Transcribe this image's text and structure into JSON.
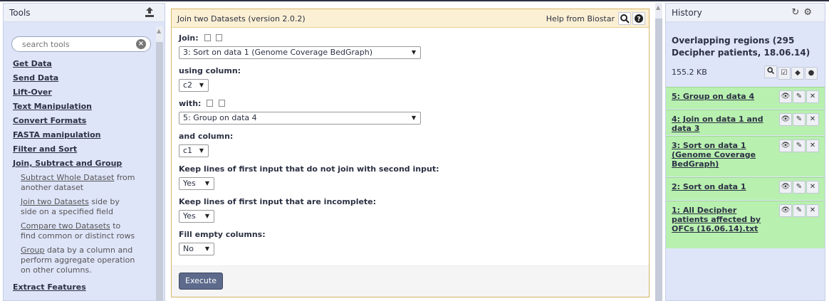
{
  "tools_panel": {
    "title": "Tools",
    "search_placeholder": "search tools",
    "sections": [
      "Get Data",
      "Send Data",
      "Lift-Over",
      "Text Manipulation",
      "Convert Formats",
      "FASTA manipulation",
      "Filter and Sort",
      "Join, Subtract and Group"
    ],
    "tools": [
      {
        "link": "Subtract Whole Dataset",
        "desc1": " from",
        "desc2": "another dataset"
      },
      {
        "link": "Join two Datasets",
        "desc1": " side by",
        "desc2": "side on a specified field"
      },
      {
        "link": "Compare two Datasets",
        "desc1": " to",
        "desc2": "find common or distinct rows"
      },
      {
        "link": "Group",
        "desc1": " data by a column and",
        "desc2": "perform aggregate operation",
        "desc3": "on other columns."
      }
    ],
    "last_section": "Extract Features"
  },
  "tool_form": {
    "title": "Join two Datasets (version 2.0.2)",
    "help": "Help from Biostar",
    "fields": [
      {
        "label": "Join:",
        "value": "3: Sort on data 1 (Genome Coverage BedGraph)"
      },
      {
        "label": "using column:",
        "value": "c2"
      },
      {
        "label": "with:",
        "value": "5: Group on data 4"
      },
      {
        "label": "and column:",
        "value": "c1"
      },
      {
        "label": "Keep lines of first input that do not join with second input:",
        "value": "Yes"
      },
      {
        "label": "Keep lines of first input that are incomplete:",
        "value": "Yes"
      },
      {
        "label": "Fill empty columns:",
        "value": "No"
      }
    ],
    "execute": "Execute"
  },
  "history": {
    "title": "History",
    "name": "Overlapping regions (295 Decipher patients, 18.06.14)",
    "size": "155.2 KB",
    "datasets": [
      {
        "name": "5: Group on data 4"
      },
      {
        "name": "4: Join on data 1 and data 3"
      },
      {
        "name": "3: Sort on data 1 (Genome Coverage BedGraph)"
      },
      {
        "name": "2: Sort on data 1"
      },
      {
        "name": "1: All Decipher patients affected by OFCs (16.06.14).txt"
      }
    ]
  }
}
